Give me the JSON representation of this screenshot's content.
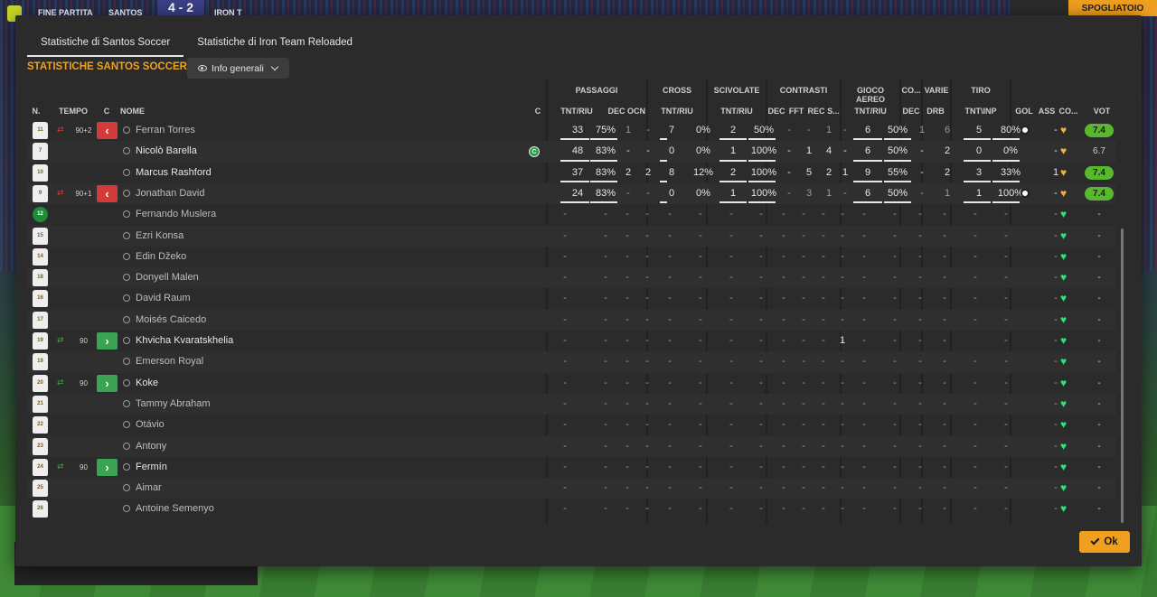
{
  "topbar": {
    "status": "FINE PARTITA",
    "home": "SANTOS",
    "score": "4 - 2",
    "away": "IRON T",
    "right_label": "SPOGLIATOIO"
  },
  "tabs": [
    {
      "label": "Statistiche di Santos Soccer",
      "active": true
    },
    {
      "label": "Statistiche di Iron Team Reloaded",
      "active": false
    }
  ],
  "title": "STATISTICHE SANTOS SOCCER",
  "dropdown": {
    "label": "Info generali"
  },
  "groups": [
    "PASSAGGI",
    "CROSS",
    "SCIVOLATE",
    "CONTRASTI",
    "GIOCO AEREO",
    "CO...",
    "VARIE",
    "TIRO"
  ],
  "headers": {
    "n": "N.",
    "tempo": "TEMPO",
    "c": "C",
    "nome": "NOME",
    "c2": "C",
    "pass_tnt": "TNT/RIU",
    "pass_dec": "DEC",
    "pass_ocn": "OCN",
    "cross_tnt": "TNT/RIU",
    "sciv_tnt": "TNT/RIU",
    "contr_dec": "DEC",
    "contr_fft": "FFT",
    "contr_rec": "REC",
    "contr_s": "S...",
    "aereo_tnt": "TNT/RIU",
    "co_dec": "DEC",
    "varie_drb": "DRB",
    "tiro_tnt": "TNT\\INP",
    "gol": "GOL",
    "ass": "ASS",
    "co": "CO...",
    "vot": "VOT"
  },
  "players": [
    {
      "num": "11",
      "time": "90+2",
      "subtype": "out",
      "name": "Ferran Torres",
      "dim": true,
      "pass": [
        "33",
        "75%"
      ],
      "pass_dec": "1",
      "pass_ocn": "-",
      "cross": [
        "7",
        "0%"
      ],
      "sciv": [
        "2",
        "50%"
      ],
      "contr": [
        "-",
        "-",
        "1",
        "-"
      ],
      "aereo": [
        "6",
        "50%"
      ],
      "co_dec": "1",
      "drb": "6",
      "tiro": [
        "5",
        "80%"
      ],
      "gol": "ball",
      "ass": "-",
      "heart": "gold",
      "vote": "7.4",
      "vote_good": true
    },
    {
      "num": "7",
      "time": "",
      "subtype": "",
      "name": "Nicolò Barella",
      "dim": false,
      "captain": "C",
      "pass": [
        "48",
        "83%"
      ],
      "pass_dec": "-",
      "pass_ocn": "-",
      "cross": [
        "0",
        "0%"
      ],
      "sciv": [
        "1",
        "100%"
      ],
      "contr": [
        "-",
        "1",
        "4",
        "-"
      ],
      "aereo": [
        "6",
        "50%"
      ],
      "co_dec": "-",
      "drb": "2",
      "tiro": [
        "0",
        "0%"
      ],
      "gol": "",
      "ass": "-",
      "heart": "gold",
      "vote": "6.7",
      "vote_good": false
    },
    {
      "num": "10",
      "time": "",
      "subtype": "",
      "name": "Marcus Rashford",
      "dim": false,
      "pass": [
        "37",
        "83%"
      ],
      "pass_dec": "2",
      "pass_ocn": "2",
      "cross": [
        "8",
        "12%"
      ],
      "sciv": [
        "2",
        "100%"
      ],
      "contr": [
        "-",
        "5",
        "2",
        "1"
      ],
      "aereo": [
        "9",
        "55%"
      ],
      "co_dec": "-",
      "drb": "2",
      "tiro": [
        "3",
        "33%"
      ],
      "gol": "",
      "ass": "1",
      "heart": "gold",
      "vote": "7.4",
      "vote_good": true
    },
    {
      "num": "9",
      "time": "90+1",
      "subtype": "out",
      "name": "Jonathan David",
      "dim": true,
      "pass": [
        "24",
        "83%"
      ],
      "pass_dec": "-",
      "pass_ocn": "-",
      "cross": [
        "0",
        "0%"
      ],
      "sciv": [
        "1",
        "100%"
      ],
      "contr": [
        "-",
        "3",
        "1",
        "-"
      ],
      "aereo": [
        "6",
        "50%"
      ],
      "co_dec": "-",
      "drb": "1",
      "tiro": [
        "1",
        "100%"
      ],
      "gol": "ball",
      "ass": "-",
      "heart": "gold",
      "vote": "7.4",
      "vote_good": true
    },
    {
      "num": "12",
      "gk": true,
      "time": "",
      "subtype": "",
      "name": "Fernando Muslera",
      "dim": true,
      "empty": true
    },
    {
      "num": "15",
      "time": "",
      "subtype": "",
      "name": "Ezri Konsa",
      "dim": true,
      "empty": true
    },
    {
      "num": "14",
      "time": "",
      "subtype": "",
      "name": "Edin Džeko",
      "dim": true,
      "empty": true
    },
    {
      "num": "18",
      "time": "",
      "subtype": "",
      "name": "Donyell Malen",
      "dim": true,
      "empty": true
    },
    {
      "num": "16",
      "time": "",
      "subtype": "",
      "name": "David Raum",
      "dim": true,
      "empty": true
    },
    {
      "num": "17",
      "time": "",
      "subtype": "",
      "name": "Moisés Caicedo",
      "dim": true,
      "empty": true
    },
    {
      "num": "19",
      "time": "90",
      "subtype": "in",
      "name": "Khvicha Kvaratskhelia",
      "dim": false,
      "empty": true,
      "contr_s": "1"
    },
    {
      "num": "19",
      "time": "",
      "subtype": "",
      "name": "Emerson Royal",
      "dim": true,
      "empty": true
    },
    {
      "num": "20",
      "time": "90",
      "subtype": "in",
      "name": "Koke",
      "dim": false,
      "empty": true
    },
    {
      "num": "21",
      "time": "",
      "subtype": "",
      "name": "Tammy Abraham",
      "dim": true,
      "empty": true
    },
    {
      "num": "22",
      "time": "",
      "subtype": "",
      "name": "Otávio",
      "dim": true,
      "empty": true
    },
    {
      "num": "23",
      "time": "",
      "subtype": "",
      "name": "Antony",
      "dim": true,
      "empty": true
    },
    {
      "num": "24",
      "time": "90",
      "subtype": "in",
      "name": "Fermín",
      "dim": false,
      "empty": true
    },
    {
      "num": "25",
      "time": "",
      "subtype": "",
      "name": "Aimar",
      "dim": true,
      "empty": true
    },
    {
      "num": "26",
      "time": "",
      "subtype": "",
      "name": "Antoine Semenyo",
      "dim": true,
      "empty": true
    }
  ],
  "ok_label": "Ok",
  "colors": {
    "accent": "#f0a020",
    "panel": "#2b2b2b",
    "good_vote": "#5ab82e",
    "heart_green": "#2fe07a",
    "heart_gold": "#f0b040"
  }
}
